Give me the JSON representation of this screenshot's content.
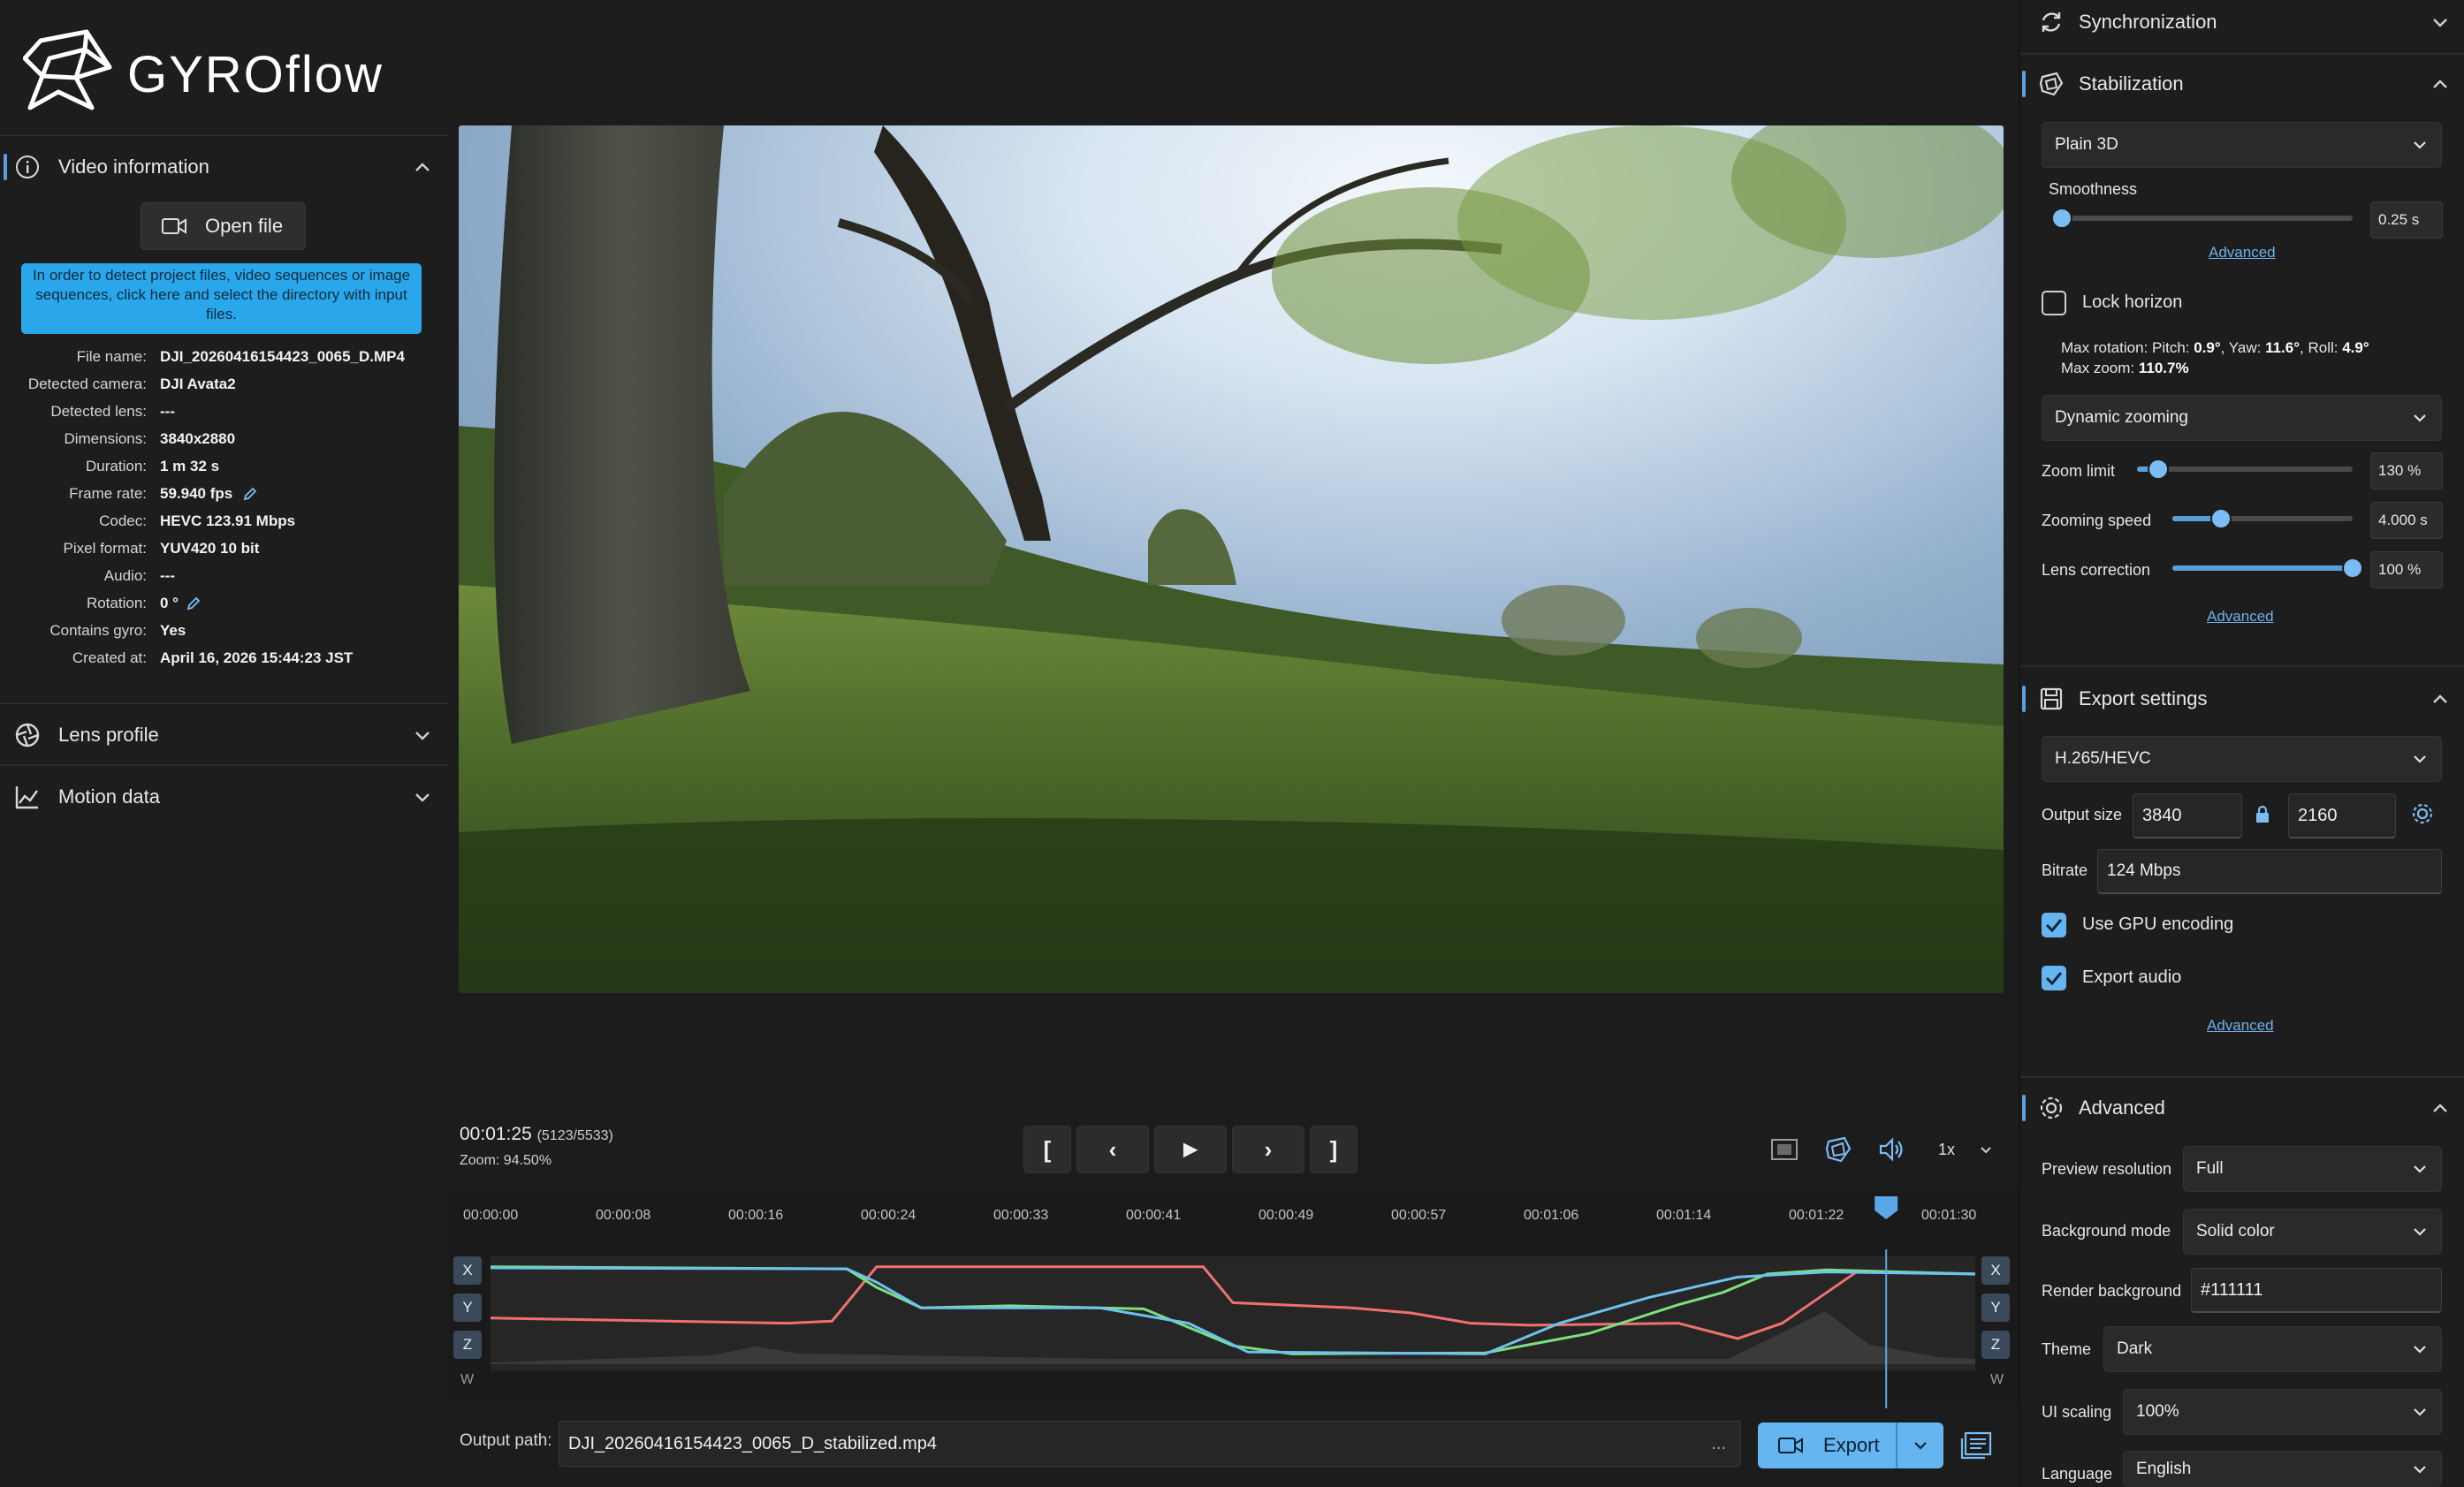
{
  "app": {
    "name": "GYROflow"
  },
  "left": {
    "video_info": {
      "title": "Video information"
    },
    "open_file_label": "Open file",
    "hint": "In order to detect project files, video sequences or image sequences, click here and select the directory with input files.",
    "fields": [
      {
        "key": "File name:",
        "value": "DJI_20260416154423_0065_D.MP4"
      },
      {
        "key": "Detected camera:",
        "value": "DJI Avata2"
      },
      {
        "key": "Detected lens:",
        "value": "---"
      },
      {
        "key": "Dimensions:",
        "value": "3840x2880"
      },
      {
        "key": "Duration:",
        "value": "1 m 32 s"
      },
      {
        "key": "Frame rate:",
        "value": "59.940 fps"
      },
      {
        "key": "Codec:",
        "value": "HEVC 123.91 Mbps"
      },
      {
        "key": "Pixel format:",
        "value": "YUV420 10 bit"
      },
      {
        "key": "Audio:",
        "value": "---"
      },
      {
        "key": "Rotation:",
        "value": "0 °"
      },
      {
        "key": "Contains gyro:",
        "value": "Yes"
      },
      {
        "key": "Created at:",
        "value": "April 16, 2026 15:44:23 JST"
      }
    ],
    "lens_profile": {
      "title": "Lens profile"
    },
    "motion_data": {
      "title": "Motion data"
    }
  },
  "player": {
    "timecode": "00:01:25",
    "frames": "(5123/5533)",
    "zoom": "Zoom: 94.50%",
    "buttons": {
      "in_point": "[",
      "prev": "‹",
      "play": "▶",
      "next": "›",
      "out_point": "]"
    },
    "speed": "1x"
  },
  "timeline": {
    "ticks": [
      "00:00:00",
      "00:00:08",
      "00:00:16",
      "00:00:24",
      "00:00:33",
      "00:00:41",
      "00:00:49",
      "00:00:57",
      "00:01:06",
      "00:01:14",
      "00:01:22",
      "00:01:30"
    ],
    "playhead_fraction": 0.94,
    "axes_left": [
      "X",
      "Y",
      "Z"
    ],
    "axes_right": [
      "X",
      "Y",
      "Z"
    ],
    "w_label": "W",
    "colors": {
      "x": "#f07070",
      "y": "#7de07d",
      "z": "#6ec3ee",
      "playhead": "#5aa8e8"
    }
  },
  "output": {
    "label": "Output path:",
    "path": "DJI_20260416154423_0065_D_stabilized.mp4",
    "dots": "...",
    "export_label": "Export"
  },
  "right": {
    "sync": {
      "title": "Synchronization"
    },
    "stab": {
      "title": "Stabilization",
      "method": "Plain 3D",
      "smoothness_label": "Smoothness",
      "smoothness_value": "0.25 s",
      "smoothness_fraction": 0.02,
      "advanced1": "Advanced",
      "lock_horizon": "Lock horizon",
      "max_rot_prefix": "Max rotation: Pitch: ",
      "pitch": "0.9°",
      "yaw_label": ", Yaw: ",
      "yaw": "11.6°",
      "roll_label": ", Roll: ",
      "roll": "4.9°",
      "max_zoom_label": "Max zoom: ",
      "max_zoom": "110.7%",
      "zoom_mode": "Dynamic zooming",
      "zoom_limit_label": "Zoom limit",
      "zoom_limit_value": "130 %",
      "zoom_limit_fraction": 0.1,
      "zoom_speed_label": "Zooming speed",
      "zoom_speed_value": "4.000 s",
      "zoom_speed_fraction": 0.27,
      "lens_corr_label": "Lens correction",
      "lens_corr_value": "100 %",
      "lens_corr_fraction": 1.0,
      "advanced2": "Advanced"
    },
    "export": {
      "title": "Export settings",
      "codec": "H.265/HEVC",
      "output_size_label": "Output size",
      "width": "3840",
      "height": "2160",
      "bitrate_label": "Bitrate",
      "bitrate": "124 Mbps",
      "gpu_label": "Use GPU encoding",
      "audio_label": "Export audio",
      "advanced": "Advanced"
    },
    "adv": {
      "title": "Advanced",
      "preview_res_label": "Preview resolution",
      "preview_res": "Full",
      "bg_mode_label": "Background mode",
      "bg_mode": "Solid color",
      "render_bg_label": "Render background",
      "render_bg": "#111111",
      "theme_label": "Theme",
      "theme": "Dark",
      "ui_scaling_label": "UI scaling",
      "ui_scaling": "100%",
      "language_label": "Language",
      "language": "English"
    }
  }
}
